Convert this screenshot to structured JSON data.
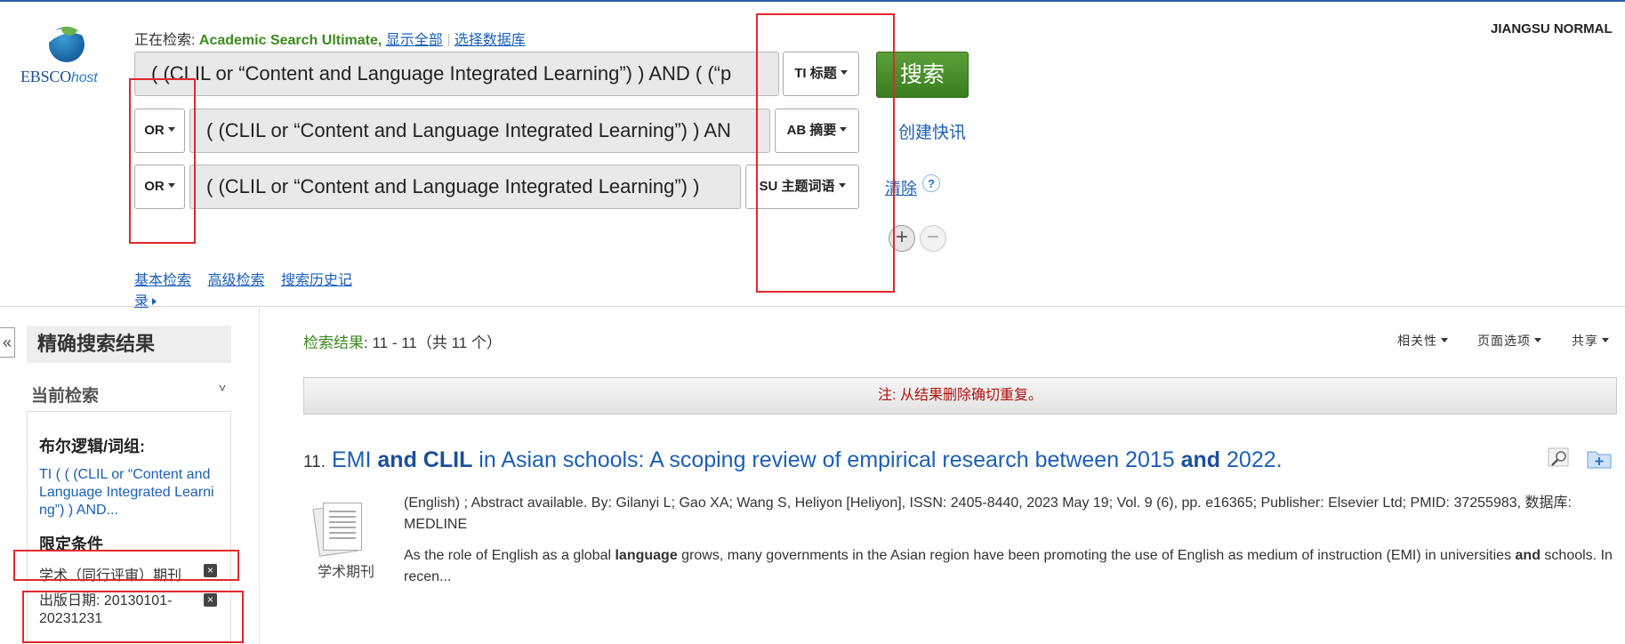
{
  "logo": {
    "brand": "EBSCO",
    "suffix": "host"
  },
  "search_header": {
    "searching_label": "正在检索:",
    "database": "Academic Search Ultimate,",
    "show_all": "显示全部",
    "choose_db": "选择数据库"
  },
  "institution": "JIANGSU NORMAL",
  "rows": [
    {
      "operator": "",
      "query": "( (CLIL or “Content and Language Integrated Learning”) ) AND ( (“p",
      "field": "TI 标题"
    },
    {
      "operator": "OR",
      "query": "( (CLIL or “Content and Language Integrated Learning”) ) AN",
      "field": "AB 摘要"
    },
    {
      "operator": "OR",
      "query": "( (CLIL or “Content and Language Integrated Learning”) )",
      "field": "SU 主题词语"
    }
  ],
  "search_button": "搜索",
  "create_alert": "创建快讯",
  "clear": "清除",
  "help": "?",
  "add_row": "+",
  "remove_row": "−",
  "nav": {
    "basic": "基本检索",
    "advanced": "高级检索",
    "history": "搜索历史记录"
  },
  "sidebar": {
    "collapse": "«",
    "refine_title": "精确搜索结果",
    "current_search": "当前检索",
    "chevron": "˅",
    "boolean_title": "布尔逻辑/词组:",
    "boolean_text": "TI ( ( (CLIL or “Content and Language Integrated Learning”) ) AND...",
    "limiters_title": "限定条件",
    "limiters": [
      {
        "label": "学术（同行评审）期刊"
      },
      {
        "label": "出版日期: 20130101-20231231"
      }
    ],
    "remove_symbol": "×"
  },
  "results": {
    "label": "检索结果",
    "range": ": 11 - 11（共 11 个）",
    "options": [
      "相关性",
      "页面选项",
      "共享"
    ],
    "notice": "注: 从结果删除确切重复。"
  },
  "result_item": {
    "number": "11.",
    "title_parts": [
      {
        "text": "EMI ",
        "bold": false
      },
      {
        "text": "and CLIL",
        "bold": true
      },
      {
        "text": " in Asian schools: A scoping review of empirical research between 2015 ",
        "bold": false
      },
      {
        "text": "and",
        "bold": true
      },
      {
        "text": " 2022.",
        "bold": false
      }
    ],
    "type_label": "学术期刊",
    "meta": "(English) ; Abstract available. By: Gilanyi L; Gao XA; Wang S, Heliyon [Heliyon], ISSN: 2405-8440, 2023 May 19; Vol. 9 (6), pp. e16365; Publisher: Elsevier Ltd; PMID: 37255983, 数据库: MEDLINE",
    "abstract_parts": [
      {
        "text": "As the role of English as a global ",
        "bold": false
      },
      {
        "text": "language",
        "bold": true
      },
      {
        "text": " grows, many governments in the Asian region have been promoting the use of English as medium of instruction (EMI) in universities ",
        "bold": false
      },
      {
        "text": "and",
        "bold": true
      },
      {
        "text": " schools. In recen...",
        "bold": false
      }
    ]
  },
  "colors": {
    "link": "#1b5fb8",
    "accent_green": "#3c8a1f",
    "highlight_box": "#e0282e",
    "notice_text": "#b01010"
  }
}
